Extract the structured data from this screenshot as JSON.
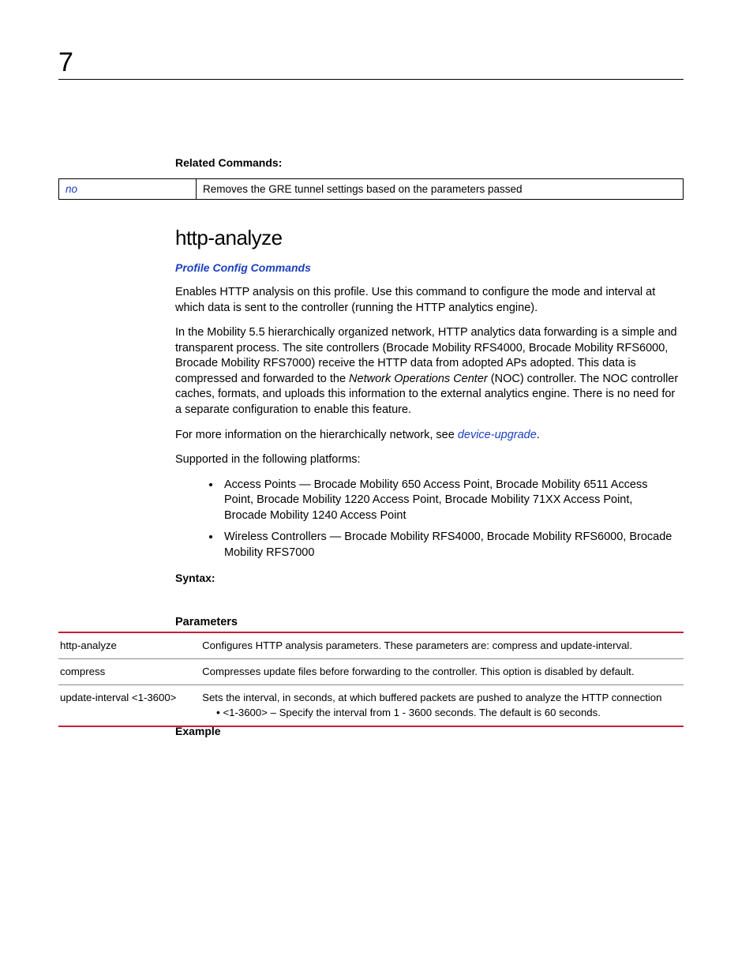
{
  "page_number": "7",
  "related_commands_heading": "Related Commands:",
  "related_table": {
    "cmd": "no",
    "desc": "Removes the GRE tunnel settings based on the parameters passed"
  },
  "section_title": "http-analyze",
  "section_link": "Profile Config Commands",
  "para1": "Enables HTTP analysis on this profile. Use this command to configure the mode and interval at which data is sent to the controller (running the HTTP analytics engine).",
  "para2_a": "In the Mobility 5.5 hierarchically organized network, HTTP analytics data forwarding is a simple and transparent process. The site controllers (Brocade Mobility RFS4000, Brocade Mobility RFS6000, Brocade Mobility RFS7000) receive the HTTP data from adopted APs adopted. This data is compressed and forwarded to the ",
  "para2_italic": "Network Operations Center",
  "para2_b": " (NOC) controller. The NOC controller caches, formats, and uploads this information to the external analytics engine. There is no need for a separate configuration to enable this feature.",
  "para3_a": "For more information on the hierarchically network, see ",
  "para3_link": "device-upgrade",
  "para3_b": ".",
  "para4": "Supported in the following platforms:",
  "platforms": [
    "Access Points — Brocade Mobility 650 Access Point, Brocade Mobility 6511 Access Point, Brocade Mobility 1220 Access Point, Brocade Mobility 71XX Access Point, Brocade Mobility 1240 Access Point",
    "Wireless Controllers — Brocade Mobility RFS4000, Brocade Mobility RFS6000, Brocade Mobility RFS7000"
  ],
  "syntax_label": "Syntax:",
  "parameters_label": "Parameters",
  "params": [
    {
      "name": "http-analyze",
      "desc": "Configures HTTP analysis parameters. These parameters are: compress and update-interval."
    },
    {
      "name": "compress",
      "desc": "Compresses update files before forwarding to the controller. This option is disabled by default."
    },
    {
      "name": "update-interval <1-3600>",
      "desc": "Sets the interval, in seconds, at which buffered packets are pushed to analyze the HTTP connection",
      "bullet": "<1-3600> – Specify the interval from 1 - 3600 seconds. The default is 60 seconds."
    }
  ],
  "example_label": "Example"
}
